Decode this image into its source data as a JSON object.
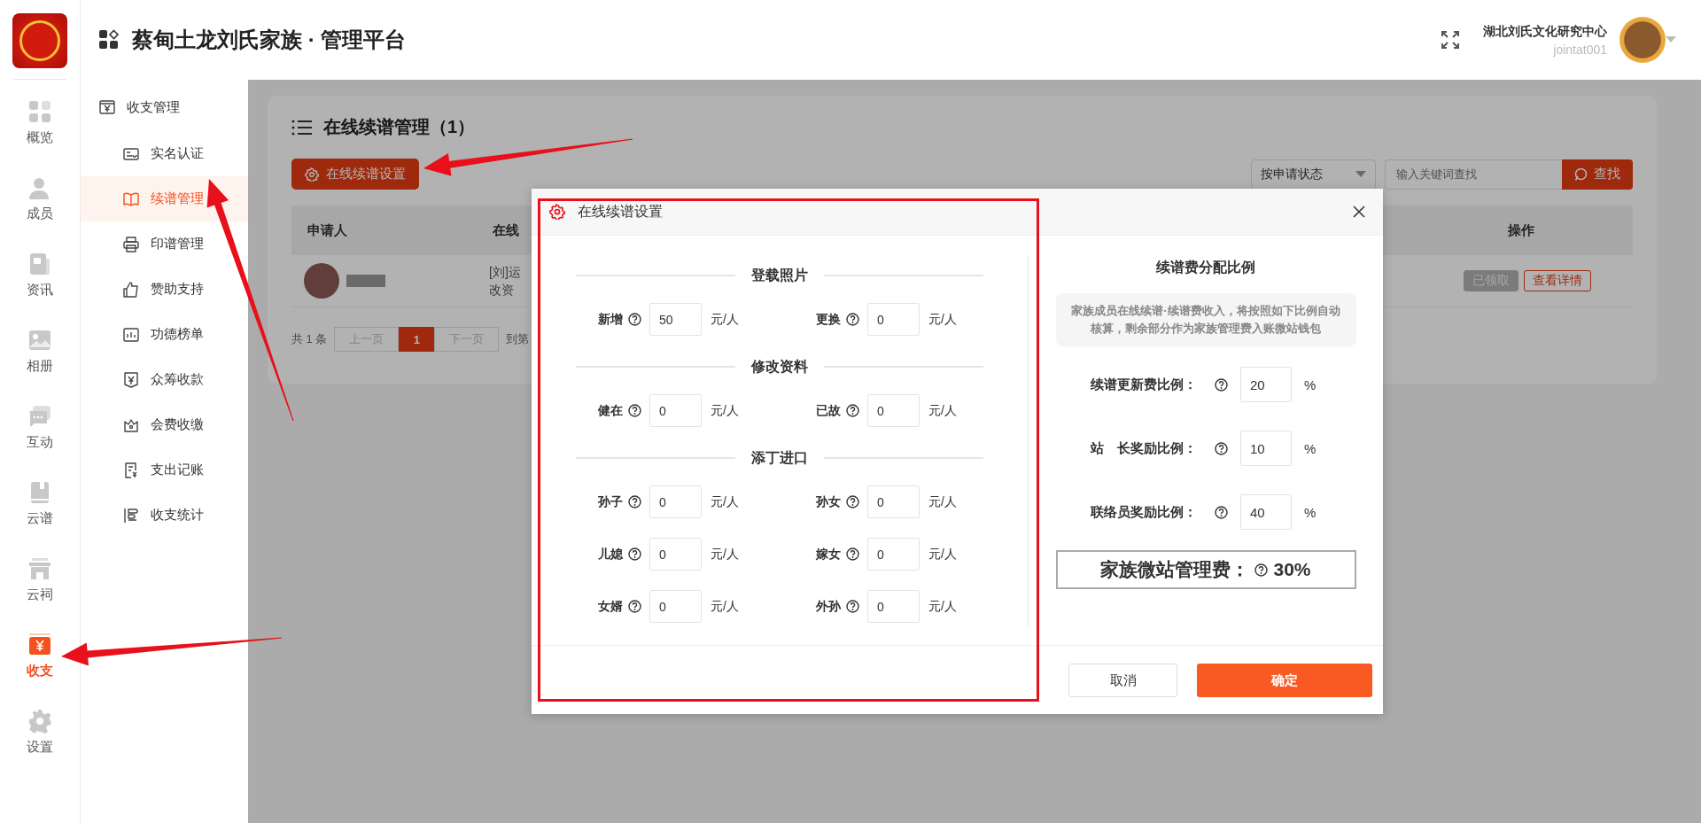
{
  "app": {
    "title": "蔡甸土龙刘氏家族 · 管理平台",
    "org": "湖北刘氏文化研究中心",
    "user": "jointat001"
  },
  "rail": [
    {
      "label": "概览",
      "selected": false
    },
    {
      "label": "成员",
      "selected": false
    },
    {
      "label": "资讯",
      "selected": false
    },
    {
      "label": "相册",
      "selected": false
    },
    {
      "label": "互动",
      "selected": false
    },
    {
      "label": "云谱",
      "selected": false
    },
    {
      "label": "云祠",
      "selected": false
    },
    {
      "label": "收支",
      "selected": true
    },
    {
      "label": "设置",
      "selected": false
    }
  ],
  "submenu": {
    "group": "收支管理",
    "items": [
      {
        "label": "实名认证",
        "selected": false
      },
      {
        "label": "续谱管理",
        "selected": true
      },
      {
        "label": "印谱管理",
        "selected": false
      },
      {
        "label": "赞助支持",
        "selected": false
      },
      {
        "label": "功德榜单",
        "selected": false
      },
      {
        "label": "众筹收款",
        "selected": false
      },
      {
        "label": "会费收缴",
        "selected": false
      },
      {
        "label": "支出记账",
        "selected": false
      },
      {
        "label": "收支统计",
        "selected": false
      }
    ]
  },
  "page": {
    "title": "在线续谱管理（1）",
    "settings_button": "在线续谱设置",
    "status_filter": "按申请状态",
    "search": {
      "placeholder": "输入关键词查找",
      "button": "查找"
    },
    "table": {
      "columns": [
        "申请人",
        "在线",
        "操作"
      ],
      "rows": [
        {
          "column_2": [
            "[刘]运",
            "改资"
          ],
          "actions": [
            {
              "label": "已领取",
              "disabled": true
            },
            {
              "label": "查看详情",
              "disabled": false
            }
          ]
        }
      ]
    },
    "pagination": {
      "total": "共 1 条",
      "prev": "上一页",
      "pages": [
        {
          "label": "1",
          "selected": true
        }
      ],
      "next": "下一页",
      "goto": "到第"
    }
  },
  "modal": {
    "title": "在线续谱设置",
    "sections": [
      {
        "heading": "登载照片",
        "fields": [
          {
            "label": "新增",
            "value": "50",
            "unit": "元/人"
          },
          {
            "label": "更换",
            "value": "0",
            "unit": "元/人"
          }
        ]
      },
      {
        "heading": "修改资料",
        "fields": [
          {
            "label": "健在",
            "value": "0",
            "unit": "元/人"
          },
          {
            "label": "已故",
            "value": "0",
            "unit": "元/人"
          }
        ]
      },
      {
        "heading": "添丁进口",
        "fields": [
          {
            "label": "孙子",
            "value": "0",
            "unit": "元/人"
          },
          {
            "label": "孙女",
            "value": "0",
            "unit": "元/人"
          },
          {
            "label": "儿媳",
            "value": "0",
            "unit": "元/人"
          },
          {
            "label": "嫁女",
            "value": "0",
            "unit": "元/人"
          },
          {
            "label": "女婿",
            "value": "0",
            "unit": "元/人"
          },
          {
            "label": "外孙",
            "value": "0",
            "unit": "元/人"
          }
        ]
      }
    ],
    "ratio": {
      "heading": "续谱费分配比例",
      "note": "家族成员在线续谱·续谱费收入，将按照如下比例自动核算，剩余部分作为家族管理费入账微站钱包",
      "rows": [
        {
          "label": "续谱更新费比例：",
          "value": "20",
          "unit": "%"
        },
        {
          "label": "站　长奖励比例：",
          "value": "10",
          "unit": "%"
        },
        {
          "label": "联络员奖励比例：",
          "value": "40",
          "unit": "%"
        }
      ],
      "total": {
        "label": "家族微站管理费：",
        "value": "30%"
      }
    },
    "buttons": {
      "cancel": "取消",
      "confirm": "确定"
    }
  }
}
